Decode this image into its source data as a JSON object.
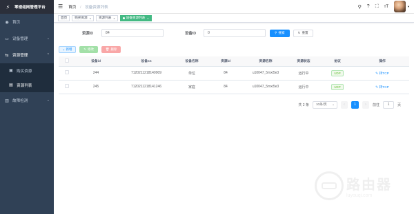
{
  "sidebar": {
    "title": "零速组网管理平台",
    "items": [
      {
        "label": "首页",
        "icon": "dashboard-icon"
      },
      {
        "label": "设备管理",
        "icon": "monitor-icon"
      },
      {
        "label": "资源管理",
        "icon": "resource-icon"
      },
      {
        "label": "购买资源",
        "icon": "cart-icon"
      },
      {
        "label": "资源列表",
        "icon": "list-icon"
      },
      {
        "label": "故障检测",
        "icon": "chart-icon"
      }
    ]
  },
  "navbar": {
    "breadcrumb_home": "首页",
    "breadcrumb_separator": "/",
    "breadcrumb_current": "设备资源列表",
    "font_icon": "тT"
  },
  "tags": [
    {
      "label": "首页"
    },
    {
      "label": "购买资源"
    },
    {
      "label": "资源列表"
    },
    {
      "label": "设备资源列表"
    }
  ],
  "search": {
    "resource_id_label": "资源ID",
    "resource_id_value": "84",
    "device_id_label": "设备ID",
    "device_id_value": "0",
    "search_button": "搜索",
    "reset_button": "重置"
  },
  "toolbar": {
    "add": "新增",
    "edit": "修改",
    "delete": "删除"
  },
  "table": {
    "headers": [
      "设备id",
      "设备sn",
      "设备名称",
      "资源id",
      "资源名称",
      "资源状态",
      "协议",
      "操作"
    ],
    "rows": [
      {
        "device_id": "244",
        "sn": "7120211218140909",
        "name": "单位",
        "resource_id": "84",
        "resource_name": "u10047_5mxi5e3",
        "status": "运行中",
        "protocol": "UDP",
        "op": "转TCP"
      },
      {
        "device_id": "245",
        "sn": "7120211218141246",
        "name": "家庭",
        "resource_id": "84",
        "resource_name": "u10047_5mxi5e3",
        "status": "运行中",
        "protocol": "UDP",
        "op": "转TCP"
      }
    ]
  },
  "pager": {
    "total": "共 2 条",
    "page_size": "10条/页",
    "current": "1",
    "goto_label": "前往",
    "goto_value": "1",
    "page_unit": "页"
  },
  "watermark": {
    "title": "路由器",
    "url": "luyouqi.com"
  },
  "colors": {
    "sidebar_bg": "#304156",
    "accent": "#1890ff",
    "tag_active": "#42b983"
  }
}
